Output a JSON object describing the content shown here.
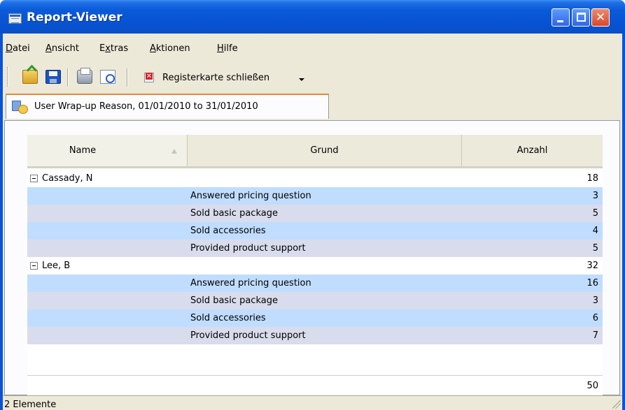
{
  "window": {
    "title": "Report-Viewer",
    "close_glyph": "✕"
  },
  "menubar": {
    "items": [
      {
        "label": "Datei",
        "mnemonic": "D",
        "rest": "atei"
      },
      {
        "label": "Ansicht",
        "mnemonic": "A",
        "rest": "nsicht"
      },
      {
        "label": "Extras",
        "mnemonic_prefix": "E",
        "mnemonic": "x",
        "rest": "tras"
      },
      {
        "label": "Aktionen",
        "mnemonic": "A",
        "rest": "ktionen"
      },
      {
        "label": "Hilfe",
        "mnemonic": "H",
        "rest": "ilfe"
      }
    ]
  },
  "toolbar": {
    "close_tab_label": "Registerkarte schließen",
    "icons": [
      "open-icon",
      "save-icon",
      "print-icon",
      "print-preview-icon",
      "close-tab-icon"
    ]
  },
  "tab": {
    "label": "User Wrap-up Reason, 01/01/2010 to 31/01/2010"
  },
  "grid": {
    "columns": [
      "Name",
      "Grund",
      "Anzahl"
    ],
    "groups": [
      {
        "name": "Cassady, N",
        "total": "18",
        "rows": [
          {
            "grund": "Answered pricing question",
            "anzahl": "3"
          },
          {
            "grund": "Sold basic package",
            "anzahl": "5"
          },
          {
            "grund": "Sold accessories",
            "anzahl": "4"
          },
          {
            "grund": "Provided product support",
            "anzahl": "5"
          }
        ]
      },
      {
        "name": "Lee, B",
        "total": "32",
        "rows": [
          {
            "grund": "Answered pricing question",
            "anzahl": "16"
          },
          {
            "grund": "Sold basic package",
            "anzahl": "3"
          },
          {
            "grund": "Sold accessories",
            "anzahl": "6"
          },
          {
            "grund": "Provided product support",
            "anzahl": "7"
          }
        ]
      }
    ],
    "grand_total": "50"
  },
  "statusbar": {
    "text": "2 Elemente"
  },
  "colors": {
    "row_alt_1": "#c0ddff",
    "row_alt_2": "#d9dcec",
    "titlebar": "#0753d3",
    "tab_accent": "#e68b2c"
  }
}
